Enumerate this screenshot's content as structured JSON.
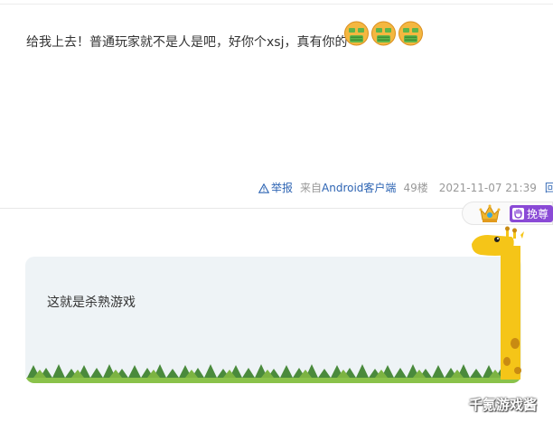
{
  "post1": {
    "text": "给我上去！普通玩家就不是人是吧，好你个xsj，真有你的",
    "emoji_count": 3,
    "emoji_icon": "money-face-emoji-icon"
  },
  "meta": {
    "report_label": "举报",
    "source_prefix": "来自",
    "source_link": "Android客户端",
    "floor": "49楼",
    "time": "2021-11-07 21:39",
    "reply_label": "回复"
  },
  "badge": {
    "vip_label": "挽尊",
    "crown_icon": "crown-icon",
    "hand_icon": "hand-icon",
    "tag_color": "#8a4ad6"
  },
  "post2": {
    "text": "这就是杀熟游戏"
  },
  "watermark": {
    "text": "千氪游戏酱"
  },
  "colors": {
    "link": "#2d64b3",
    "card_bg": "#eef3f6",
    "grass_dark": "#4a8a3c",
    "grass_light": "#8ac24a",
    "giraffe": "#f5c518"
  }
}
